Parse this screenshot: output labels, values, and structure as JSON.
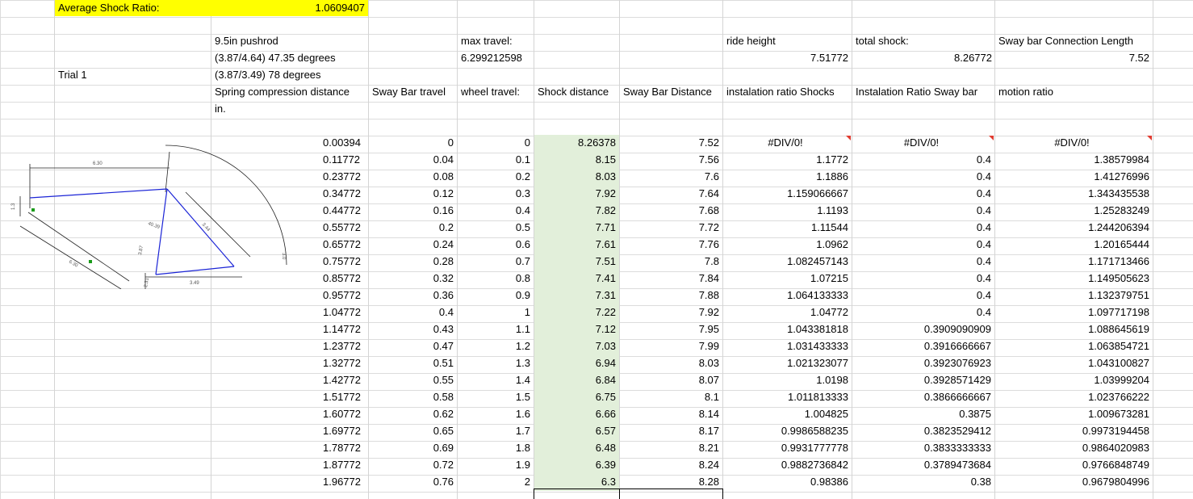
{
  "summary": {
    "avg_label": "Average Shock Ratio:",
    "avg_value": "1.0609407"
  },
  "header": {
    "trial": "Trial 1",
    "pushrod": "9.5in pushrod",
    "angle1": "(3.87/4.64) 47.35 degrees",
    "angle2": "(3.87/3.49) 78 degrees",
    "max_travel_label": "max travel:",
    "max_travel_value": "6.299212598",
    "ride_height_label": "ride height",
    "ride_height_value": "7.51772",
    "total_shock_label": "total shock:",
    "total_shock_value": "8.26772",
    "sway_conn_label": "Sway bar Connection Length",
    "sway_conn_value": "7.52"
  },
  "columns": [
    "Spring compression distance",
    "in.",
    "Sway Bar travel",
    "wheel travel:",
    "Shock distance",
    "Sway Bar Distance",
    "instalation ratio Shocks",
    "Instalation Ratio Sway bar",
    "motion ratio"
  ],
  "diagram_labels": [
    "6.30",
    "1.3",
    "40.39",
    "3.44",
    "3.87",
    "6.30",
    "3.49",
    "3.0",
    "2.31"
  ],
  "rows": [
    [
      "0.00394",
      "0",
      "0",
      "8.26378",
      "7.52",
      "#DIV/0!",
      "#DIV/0!",
      "#DIV/0!"
    ],
    [
      "0.11772",
      "0.04",
      "0.1",
      "8.15",
      "7.56",
      "1.1772",
      "0.4",
      "1.38579984"
    ],
    [
      "0.23772",
      "0.08",
      "0.2",
      "8.03",
      "7.6",
      "1.1886",
      "0.4",
      "1.41276996"
    ],
    [
      "0.34772",
      "0.12",
      "0.3",
      "7.92",
      "7.64",
      "1.159066667",
      "0.4",
      "1.343435538"
    ],
    [
      "0.44772",
      "0.16",
      "0.4",
      "7.82",
      "7.68",
      "1.1193",
      "0.4",
      "1.25283249"
    ],
    [
      "0.55772",
      "0.2",
      "0.5",
      "7.71",
      "7.72",
      "1.11544",
      "0.4",
      "1.244206394"
    ],
    [
      "0.65772",
      "0.24",
      "0.6",
      "7.61",
      "7.76",
      "1.0962",
      "0.4",
      "1.20165444"
    ],
    [
      "0.75772",
      "0.28",
      "0.7",
      "7.51",
      "7.8",
      "1.082457143",
      "0.4",
      "1.171713466"
    ],
    [
      "0.85772",
      "0.32",
      "0.8",
      "7.41",
      "7.84",
      "1.07215",
      "0.4",
      "1.149505623"
    ],
    [
      "0.95772",
      "0.36",
      "0.9",
      "7.31",
      "7.88",
      "1.064133333",
      "0.4",
      "1.132379751"
    ],
    [
      "1.04772",
      "0.4",
      "1",
      "7.22",
      "7.92",
      "1.04772",
      "0.4",
      "1.097717198"
    ],
    [
      "1.14772",
      "0.43",
      "1.1",
      "7.12",
      "7.95",
      "1.043381818",
      "0.3909090909",
      "1.088645619"
    ],
    [
      "1.23772",
      "0.47",
      "1.2",
      "7.03",
      "7.99",
      "1.031433333",
      "0.3916666667",
      "1.063854721"
    ],
    [
      "1.32772",
      "0.51",
      "1.3",
      "6.94",
      "8.03",
      "1.021323077",
      "0.3923076923",
      "1.043100827"
    ],
    [
      "1.42772",
      "0.55",
      "1.4",
      "6.84",
      "8.07",
      "1.0198",
      "0.3928571429",
      "1.03999204"
    ],
    [
      "1.51772",
      "0.58",
      "1.5",
      "6.75",
      "8.1",
      "1.011813333",
      "0.3866666667",
      "1.023766222"
    ],
    [
      "1.60772",
      "0.62",
      "1.6",
      "6.66",
      "8.14",
      "1.004825",
      "0.3875",
      "1.009673281"
    ],
    [
      "1.69772",
      "0.65",
      "1.7",
      "6.57",
      "8.17",
      "0.9986588235",
      "0.3823529412",
      "0.9973194458"
    ],
    [
      "1.78772",
      "0.69",
      "1.8",
      "6.48",
      "8.21",
      "0.9931777778",
      "0.3833333333",
      "0.9864020983"
    ],
    [
      "1.87772",
      "0.72",
      "1.9",
      "6.39",
      "8.24",
      "0.9882736842",
      "0.3789473684",
      "0.9766848749"
    ],
    [
      "1.96772",
      "0.76",
      "2",
      "6.3",
      "8.28",
      "0.98386",
      "0.38",
      "0.9679804996"
    ]
  ]
}
